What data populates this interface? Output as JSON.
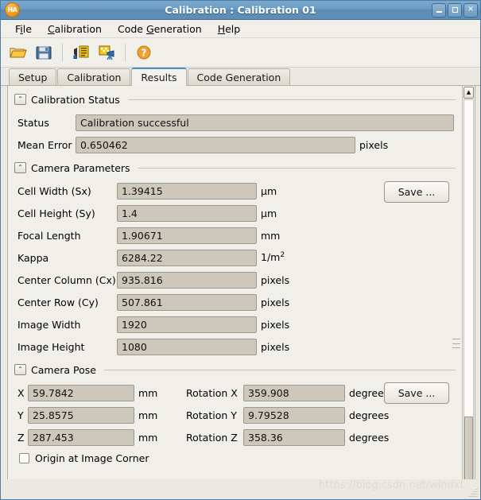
{
  "window": {
    "title": "Calibration : Calibration 01",
    "app_icon": "halcon-ha-icon",
    "buttons": {
      "minimize": "minimize-button",
      "maximize": "maximize-button",
      "close": "✕"
    }
  },
  "menubar": {
    "items": [
      {
        "pre": "F",
        "acc": "i",
        "post": "le"
      },
      {
        "pre": "",
        "acc": "C",
        "post": "alibration"
      },
      {
        "pre": "Code ",
        "acc": "G",
        "post": "eneration"
      },
      {
        "pre": "",
        "acc": "H",
        "post": "elp"
      }
    ]
  },
  "toolbar": {
    "items": [
      {
        "name": "open-icon"
      },
      {
        "name": "save-icon"
      },
      {
        "name": "separator"
      },
      {
        "name": "insert-code-icon"
      },
      {
        "name": "calibration-setup-icon"
      },
      {
        "name": "separator"
      },
      {
        "name": "help-icon"
      }
    ]
  },
  "tabs": [
    {
      "label": "Setup",
      "active": false
    },
    {
      "label": "Calibration",
      "active": false
    },
    {
      "label": "Results",
      "active": true
    },
    {
      "label": "Code Generation",
      "active": false
    }
  ],
  "sections": {
    "status": {
      "title": "Calibration Status",
      "collapse_glyph": "⌃",
      "rows": [
        {
          "label": "Status",
          "value": "Calibration successful",
          "unit": ""
        },
        {
          "label": "Mean Error",
          "value": "0.650462",
          "unit": "pixels"
        }
      ]
    },
    "camera_parameters": {
      "title": "Camera Parameters",
      "collapse_glyph": "⌃",
      "save_label": "Save ...",
      "rows": [
        {
          "label": "Cell Width (Sx)",
          "value": "1.39415",
          "unit": "µm"
        },
        {
          "label": "Cell Height (Sy)",
          "value": "1.4",
          "unit": "µm"
        },
        {
          "label": "Focal Length",
          "value": "1.90671",
          "unit": "mm"
        },
        {
          "label": "Kappa",
          "value": "6284.22",
          "unit": "1/m",
          "unit_sup": "2"
        },
        {
          "label": "Center Column (Cx)",
          "value": "935.816",
          "unit": "pixels"
        },
        {
          "label": "Center Row (Cy)",
          "value": "507.861",
          "unit": "pixels"
        },
        {
          "label": "Image Width",
          "value": "1920",
          "unit": "pixels"
        },
        {
          "label": "Image Height",
          "value": "1080",
          "unit": "pixels"
        }
      ]
    },
    "camera_pose": {
      "title": "Camera Pose",
      "collapse_glyph": "⌃",
      "save_label": "Save ...",
      "rows": [
        {
          "label": "X",
          "value": "59.7842",
          "unit": "mm",
          "label2": "Rotation X",
          "value2": "359.908",
          "unit2": "degrees"
        },
        {
          "label": "Y",
          "value": "25.8575",
          "unit": "mm",
          "label2": "Rotation Y",
          "value2": "9.79528",
          "unit2": "degrees"
        },
        {
          "label": "Z",
          "value": "287.453",
          "unit": "mm",
          "label2": "Rotation Z",
          "value2": "358.36",
          "unit2": "degrees"
        }
      ],
      "checkbox": {
        "label": "Origin at Image Corner",
        "checked": false
      }
    }
  },
  "scrollbar": {
    "up_glyph": "▲",
    "down_glyph": "▼"
  },
  "watermark": "https://blog.csdn.net/windxf",
  "colors": {
    "title_bar": "#6b9cc4",
    "window_bg": "#ece9e2",
    "field_bg": "#cdc7bc",
    "active_tab_accent": "#4f8ec4",
    "icon_yellow": "#f5c518"
  }
}
